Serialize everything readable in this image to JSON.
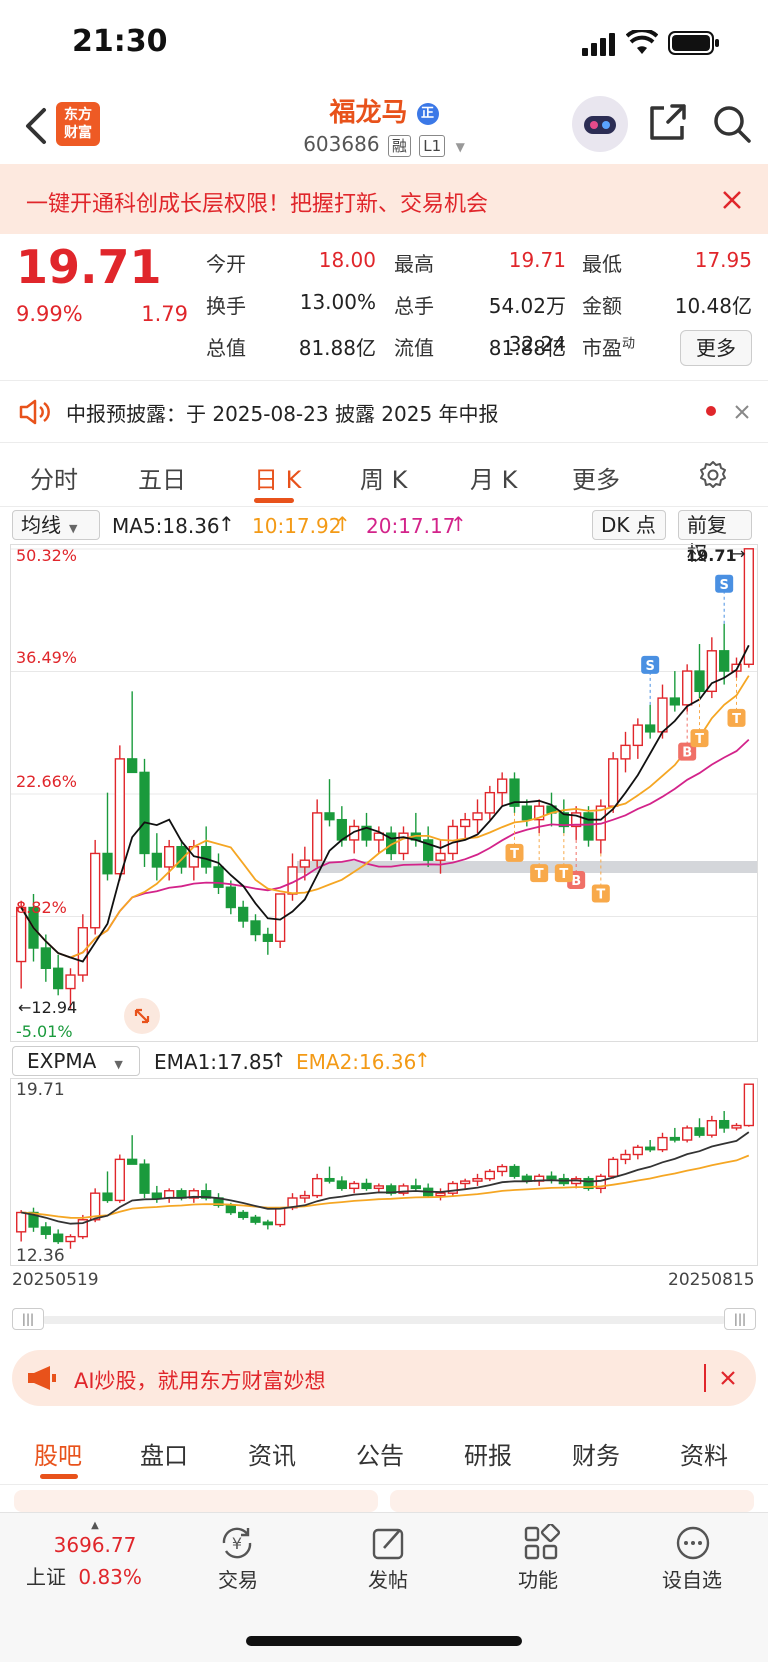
{
  "status_bar": {
    "time": "21:30"
  },
  "header": {
    "logo_line1": "东方",
    "logo_line2": "财富",
    "stock_name": "福龙马",
    "name_badge": "正",
    "stock_code": "603686",
    "tag_margin": "融",
    "tag_level": "L1"
  },
  "banner": {
    "text": "一键开通科创成长层权限！把握打新、交易机会"
  },
  "quote": {
    "price": "19.71",
    "change_pct": "9.99%",
    "change": "1.79",
    "fields": [
      {
        "label": "今开",
        "value": "18.00",
        "color": "red"
      },
      {
        "label": "最高",
        "value": "19.71",
        "color": "red"
      },
      {
        "label": "最低",
        "value": "17.95",
        "color": "red"
      },
      {
        "label": "换手",
        "value": "13.00%",
        "color": "black"
      },
      {
        "label": "总手",
        "value": "54.02万",
        "color": "black"
      },
      {
        "label": "金额",
        "value": "10.48亿",
        "color": "black"
      },
      {
        "label": "总值",
        "value": "81.88亿",
        "color": "black"
      },
      {
        "label": "流值",
        "value": "81.88亿",
        "color": "black"
      },
      {
        "label": "市盈动",
        "value": "32.24",
        "color": "black"
      }
    ],
    "more_button": "更多"
  },
  "announcement": {
    "text": "中报预披露：于 2025-08-23 披露 2025 年中报"
  },
  "tabs": [
    {
      "label": "分时"
    },
    {
      "label": "五日"
    },
    {
      "label": "日 K",
      "active": true
    },
    {
      "label": "周 K"
    },
    {
      "label": "月 K"
    },
    {
      "label": "更多"
    }
  ],
  "indicator_bar": {
    "selector": "均线",
    "ma5": "MA5:18.36",
    "ma10": "10:17.92",
    "ma20": "20:17.17",
    "dk_button": "DK 点",
    "adjust_button": "前复权"
  },
  "main_chart": {
    "pct_labels": [
      "50.32%",
      "36.49%",
      "22.66%",
      "8.82%",
      "-5.01%"
    ],
    "last_price_label": "19.71",
    "low_label": "12.94",
    "marker_b": "B",
    "marker_s": "S",
    "marker_t": "T"
  },
  "sub_indicator": {
    "selector": "EXPMA",
    "ema1": "EMA1:17.85",
    "ema2": "EMA2:16.36",
    "top_label": "19.71",
    "bottom_label": "12.36",
    "start_date": "20250519",
    "end_date": "20250815"
  },
  "ai_banner": {
    "text": "AI炒股，就用东方财富妙想"
  },
  "bottom_tabs": [
    {
      "label": "股吧",
      "active": true
    },
    {
      "label": "盘口"
    },
    {
      "label": "资讯"
    },
    {
      "label": "公告"
    },
    {
      "label": "研报"
    },
    {
      "label": "财务"
    },
    {
      "label": "资料"
    }
  ],
  "bottom_bar": {
    "index_value": "3696.77",
    "index_name": "上证",
    "index_change": "0.83%",
    "items": [
      {
        "label": "交易",
        "icon": "yuan-exchange-icon"
      },
      {
        "label": "发帖",
        "icon": "edit-icon"
      },
      {
        "label": "功能",
        "icon": "grid-icon"
      },
      {
        "label": "设自选",
        "icon": "more-dots-icon"
      }
    ]
  },
  "colors": {
    "up": "#e0262b",
    "down": "#1a9a3c",
    "accent": "#e8521b",
    "ma10": "#f5a623",
    "ma20": "#d3238a"
  },
  "chart_data": {
    "type": "candlestick",
    "x_start": "20250519",
    "x_end": "20250815",
    "ylim_pct": [
      -5.01,
      50.32
    ],
    "price_range": [
      12.36,
      19.71
    ],
    "candles": [
      [
        13.6,
        14.5,
        13.2,
        14.4
      ],
      [
        14.4,
        14.6,
        13.6,
        13.8
      ],
      [
        13.8,
        14.0,
        13.3,
        13.5
      ],
      [
        13.5,
        13.7,
        13.1,
        13.2
      ],
      [
        13.2,
        13.5,
        12.9,
        13.4
      ],
      [
        13.4,
        14.3,
        13.3,
        14.1
      ],
      [
        14.1,
        15.4,
        14.0,
        15.2
      ],
      [
        15.2,
        16.1,
        14.8,
        14.9
      ],
      [
        14.9,
        16.8,
        14.8,
        16.6
      ],
      [
        16.6,
        17.6,
        16.4,
        16.4
      ],
      [
        16.4,
        16.6,
        15.0,
        15.2
      ],
      [
        15.2,
        15.5,
        14.8,
        15.0
      ],
      [
        15.0,
        15.4,
        14.8,
        15.3
      ],
      [
        15.3,
        15.4,
        14.9,
        15.0
      ],
      [
        15.0,
        15.4,
        14.8,
        15.3
      ],
      [
        15.3,
        15.6,
        14.9,
        15.0
      ],
      [
        15.0,
        15.2,
        14.6,
        14.7
      ],
      [
        14.7,
        14.8,
        14.3,
        14.4
      ],
      [
        14.4,
        14.5,
        14.1,
        14.2
      ],
      [
        14.2,
        14.3,
        13.9,
        14.0
      ],
      [
        14.0,
        14.1,
        13.7,
        13.9
      ],
      [
        13.9,
        14.6,
        13.8,
        14.6
      ],
      [
        14.6,
        15.2,
        14.5,
        15.0
      ],
      [
        15.0,
        15.3,
        14.8,
        15.1
      ],
      [
        15.1,
        16.0,
        15.0,
        15.8
      ],
      [
        15.8,
        16.3,
        15.6,
        15.7
      ],
      [
        15.7,
        15.9,
        15.3,
        15.4
      ],
      [
        15.4,
        15.7,
        15.2,
        15.6
      ],
      [
        15.6,
        15.8,
        15.3,
        15.4
      ],
      [
        15.4,
        15.6,
        15.2,
        15.5
      ],
      [
        15.5,
        15.6,
        15.1,
        15.2
      ],
      [
        15.2,
        15.6,
        15.1,
        15.5
      ],
      [
        15.5,
        15.8,
        15.3,
        15.4
      ],
      [
        15.4,
        15.6,
        15.0,
        15.1
      ],
      [
        15.1,
        15.4,
        14.9,
        15.2
      ],
      [
        15.2,
        15.7,
        15.1,
        15.6
      ],
      [
        15.6,
        15.8,
        15.4,
        15.7
      ],
      [
        15.7,
        16.0,
        15.5,
        15.8
      ],
      [
        15.8,
        16.2,
        15.7,
        16.1
      ],
      [
        16.1,
        16.4,
        15.9,
        16.3
      ],
      [
        16.3,
        16.4,
        15.8,
        15.9
      ],
      [
        15.9,
        16.0,
        15.6,
        15.7
      ],
      [
        15.7,
        16.0,
        15.5,
        15.9
      ],
      [
        15.9,
        16.1,
        15.6,
        15.8
      ],
      [
        15.8,
        16.0,
        15.5,
        15.6
      ],
      [
        15.6,
        15.9,
        15.4,
        15.8
      ],
      [
        15.8,
        15.9,
        15.3,
        15.4
      ],
      [
        15.4,
        16.0,
        15.2,
        15.9
      ],
      [
        15.9,
        16.7,
        15.8,
        16.6
      ],
      [
        16.6,
        17.0,
        16.4,
        16.8
      ],
      [
        16.8,
        17.2,
        16.6,
        17.1
      ],
      [
        17.1,
        17.4,
        16.9,
        17.0
      ],
      [
        17.0,
        17.7,
        16.9,
        17.5
      ],
      [
        17.5,
        17.9,
        17.3,
        17.4
      ],
      [
        17.4,
        18.0,
        17.3,
        17.9
      ],
      [
        17.9,
        18.3,
        17.5,
        17.6
      ],
      [
        17.6,
        18.4,
        17.5,
        18.2
      ],
      [
        18.2,
        18.6,
        17.7,
        17.9
      ],
      [
        17.9,
        18.1,
        17.8,
        18.0
      ],
      [
        18.0,
        19.71,
        17.95,
        19.71
      ]
    ]
  }
}
